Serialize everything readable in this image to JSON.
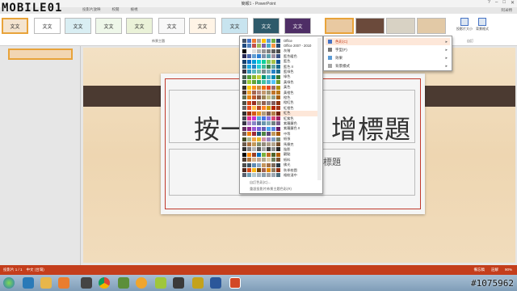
{
  "app": {
    "window_title": "簡報1 - PowerPoint",
    "window_controls": [
      "?",
      "–",
      "□",
      "✕"
    ],
    "user": "阿米特"
  },
  "tabs": [
    {
      "label": "投影片放映",
      "active": false
    },
    {
      "label": "校閱",
      "active": false
    },
    {
      "label": "檢視",
      "active": false
    }
  ],
  "ribbon": {
    "theme_label": "文文",
    "themes_group_label": "佈景主題",
    "buttons": [
      {
        "label": "投影片大小",
        "icon": "slide-size-icon"
      },
      {
        "label": "背景格式",
        "icon": "format-background-icon"
      }
    ],
    "customize_group_label": "自訂"
  },
  "color_scheme_menu": {
    "items": [
      {
        "label": "Office",
        "colors": [
          "#44546a",
          "#4472c4",
          "#ed7d31",
          "#a5a5a5",
          "#ffc000",
          "#5b9bd5",
          "#70ad47",
          "#264478"
        ]
      },
      {
        "label": "Office 2007 - 2010",
        "colors": [
          "#1f497d",
          "#4f81bd",
          "#c0504d",
          "#9bbb59",
          "#8064a2",
          "#4bacc6",
          "#f79646",
          "#2c4d75"
        ]
      },
      {
        "label": "灰階",
        "colors": [
          "#000000",
          "#f8f8f8",
          "#ddd",
          "#b2b2b2",
          "#969696",
          "#808080",
          "#5f5f5f",
          "#4d4d4d"
        ]
      },
      {
        "label": "藍色暖色",
        "colors": [
          "#242852",
          "#4a66ac",
          "#629dd1",
          "#297fd5",
          "#7f8fa9",
          "#5aa2ae",
          "#9d90a0",
          "#3a5384"
        ]
      },
      {
        "label": "藍色",
        "colors": [
          "#17406d",
          "#0f6fc6",
          "#009dd9",
          "#0bd0d9",
          "#10cf9b",
          "#7cca62",
          "#a5c249",
          "#0a5394"
        ]
      },
      {
        "label": "藍色 II",
        "colors": [
          "#335b74",
          "#1cade4",
          "#2683c6",
          "#27ced7",
          "#42ba97",
          "#3e8853",
          "#62a39f",
          "#1a6b8f"
        ]
      },
      {
        "label": "藍綠色",
        "colors": [
          "#373545",
          "#3494ba",
          "#58b6c0",
          "#75bda7",
          "#7a8c8e",
          "#84acb6",
          "#2683c6",
          "#1f6f8b"
        ]
      },
      {
        "label": "綠色",
        "colors": [
          "#455f51",
          "#549e39",
          "#8ab833",
          "#c0cf3a",
          "#029676",
          "#4ab5c4",
          "#0989b1",
          "#3b7a2d"
        ]
      },
      {
        "label": "黃綠色",
        "colors": [
          "#455f51",
          "#99cb38",
          "#63a537",
          "#37a76f",
          "#44c1a3",
          "#4eb3cf",
          "#51c3f9",
          "#6f9a2b"
        ]
      },
      {
        "label": "黃色",
        "colors": [
          "#39302a",
          "#ffca08",
          "#f8931d",
          "#ce8d3e",
          "#ec7016",
          "#e64823",
          "#9c6a6a",
          "#b38f00"
        ]
      },
      {
        "label": "黃橙色",
        "colors": [
          "#4e3b30",
          "#f0a22e",
          "#a5644e",
          "#b58b80",
          "#c3986d",
          "#a19574",
          "#c17529",
          "#b8761a"
        ]
      },
      {
        "label": "橙色",
        "colors": [
          "#637052",
          "#e48312",
          "#bd582c",
          "#865640",
          "#9b8357",
          "#c2bc80",
          "#94a088",
          "#a55d0c"
        ]
      },
      {
        "label": "橙紅色",
        "colors": [
          "#505046",
          "#d34817",
          "#9b2d1f",
          "#a28e6a",
          "#956251",
          "#918485",
          "#855d5d",
          "#8e3210"
        ]
      },
      {
        "label": "紅橙色",
        "colors": [
          "#696464",
          "#e84c22",
          "#ffbd47",
          "#b64926",
          "#ff8427",
          "#cc9900",
          "#b22600",
          "#a33618"
        ]
      },
      {
        "label": "紅色",
        "colors": [
          "#323232",
          "#a5300f",
          "#d55816",
          "#e19825",
          "#b19c7d",
          "#7f5f52",
          "#b27d49",
          "#73210a"
        ]
      },
      {
        "label": "紅紫色",
        "colors": [
          "#454551",
          "#e32d91",
          "#c830cc",
          "#4ea6dc",
          "#4775e7",
          "#8971e1",
          "#d54773",
          "#9f1f66"
        ]
      },
      {
        "label": "紫羅蘭色",
        "colors": [
          "#373545",
          "#ad84c6",
          "#8784c7",
          "#5d739a",
          "#6997af",
          "#84acb6",
          "#6f8183",
          "#7a5c8b"
        ]
      },
      {
        "label": "紫羅蘭色 II",
        "colors": [
          "#632e62",
          "#92278f",
          "#9b57d3",
          "#755dd9",
          "#665eb8",
          "#45a5ed",
          "#5982db",
          "#661b64"
        ]
      },
      {
        "label": "中等",
        "colors": [
          "#775f55",
          "#f07f09",
          "#9f2936",
          "#1b587c",
          "#4e8542",
          "#604878",
          "#c19859",
          "#a85906"
        ]
      },
      {
        "label": "紙張",
        "colors": [
          "#444d26",
          "#a5b592",
          "#f3a447",
          "#e7bc29",
          "#d092a7",
          "#9c85c0",
          "#809ec2",
          "#737f66"
        ]
      },
      {
        "label": "馬賽克",
        "colors": [
          "#6b5b4d",
          "#ac7340",
          "#c19859",
          "#828e6f",
          "#948c7c",
          "#ad9e88",
          "#b3a48e",
          "#78502d"
        ]
      },
      {
        "label": "陰影",
        "colors": [
          "#323232",
          "#7f7f7f",
          "#b2b2b2",
          "#595959",
          "#a5a5a5",
          "#404040",
          "#8c8c8c",
          "#262626"
        ]
      },
      {
        "label": "觀點",
        "colors": [
          "#000000",
          "#ff8600",
          "#9b3f22",
          "#0070c0",
          "#7ab03b",
          "#c46b22",
          "#4f6228",
          "#b35e00"
        ]
      },
      {
        "label": "紙料",
        "colors": [
          "#4e3b30",
          "#ac7340",
          "#d7b189",
          "#c4a68e",
          "#b2a98f",
          "#dccca5",
          "#6e7e5c",
          "#785030"
        ]
      },
      {
        "label": "佛光",
        "colors": [
          "#4d4d4d",
          "#3d5466",
          "#5d8ab3",
          "#8ba7c2",
          "#c4955c",
          "#a37147",
          "#7d6a5b",
          "#2b3b47"
        ]
      },
      {
        "label": "秋季校園",
        "colors": [
          "#4f271c",
          "#d34817",
          "#f7b615",
          "#704404",
          "#a5644e",
          "#e38a00",
          "#8f7a5e",
          "#932f10"
        ]
      },
      {
        "label": "格紋淺中",
        "colors": [
          "#575f6d",
          "#6e9db3",
          "#b3c7ce",
          "#a5b3bf",
          "#8c9eaa",
          "#a2a3a6",
          "#9ba6b1",
          "#4c6e7d"
        ]
      }
    ],
    "footer": [
      "自訂色彩(C)...",
      "重設投影片佈景主題色彩(R)"
    ]
  },
  "variants_menu": {
    "items": [
      {
        "label": "色彩(C)",
        "icon": "colors-icon",
        "submenu": true
      },
      {
        "label": "字型(F)",
        "icon": "fonts-icon",
        "submenu": true
      },
      {
        "label": "效果",
        "icon": "effects-icon",
        "submenu": true
      },
      {
        "label": "背景樣式",
        "icon": "background-styles-icon",
        "submenu": true
      }
    ]
  },
  "slide": {
    "title_left": "按一",
    "title_right": "增標題",
    "subtitle": "標題"
  },
  "thumbnail_panel": {
    "number": "1"
  },
  "status_bar": {
    "slide_info": "投影片 1 / 1",
    "language": "中文 (台灣)",
    "notes": "備忘稿",
    "comments": "註解",
    "zoom": "90%"
  },
  "taskbar": {
    "apps": [
      "windows-orb",
      "ie-icon",
      "folder-icon",
      "media-icon",
      "chrome-icon",
      "app-icon",
      "app-icon",
      "app-icon",
      "word-icon",
      "powerpoint-icon"
    ]
  },
  "watermarks": {
    "logo": "MOBILE01",
    "id": "#1075962"
  },
  "colors": {
    "accent": "#c43e1c",
    "slide_band": "#4b3a31",
    "slide_bg": "#eed6b1"
  }
}
